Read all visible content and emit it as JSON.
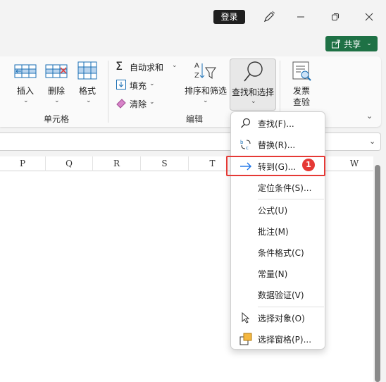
{
  "titlebar": {
    "login_label": "登录",
    "share_label": "共享",
    "share_chevron": "⌄"
  },
  "ribbon": {
    "insert_label": "插入",
    "delete_label": "删除",
    "format_label": "格式",
    "cells_group_label": "单元格",
    "autosum_label": "自动求和",
    "fill_label": "填充",
    "clear_label": "清除",
    "sort_filter_label": "排序和筛选",
    "find_select_label": "查找和选择",
    "editing_group_label": "编辑",
    "invoice_check_line1": "发票",
    "invoice_check_line2": "查验",
    "chevron": "⌄",
    "sigma": "Σ"
  },
  "columns": [
    "P",
    "Q",
    "R",
    "S",
    "T",
    "W"
  ],
  "menu": {
    "items": [
      {
        "label": "查找(F)...",
        "icon": "search-icon"
      },
      {
        "label": "替换(R)...",
        "icon": "replace-icon"
      },
      {
        "label": "转到(G)...",
        "icon": "arrow-right-icon"
      },
      {
        "label": "定位条件(S)...",
        "icon": ""
      },
      {
        "label": "公式(U)",
        "icon": ""
      },
      {
        "label": "批注(M)",
        "icon": ""
      },
      {
        "label": "条件格式(C)",
        "icon": ""
      },
      {
        "label": "常量(N)",
        "icon": ""
      },
      {
        "label": "数据验证(V)",
        "icon": ""
      },
      {
        "label": "选择对象(O)",
        "icon": "cursor-icon"
      },
      {
        "label": "选择窗格(P)...",
        "icon": "selection-pane-icon"
      }
    ]
  },
  "annotation": {
    "badge": "1"
  },
  "colors": {
    "accent_green": "#1e7145",
    "highlight_red": "#e53935",
    "arrow_blue": "#1a73e8"
  }
}
